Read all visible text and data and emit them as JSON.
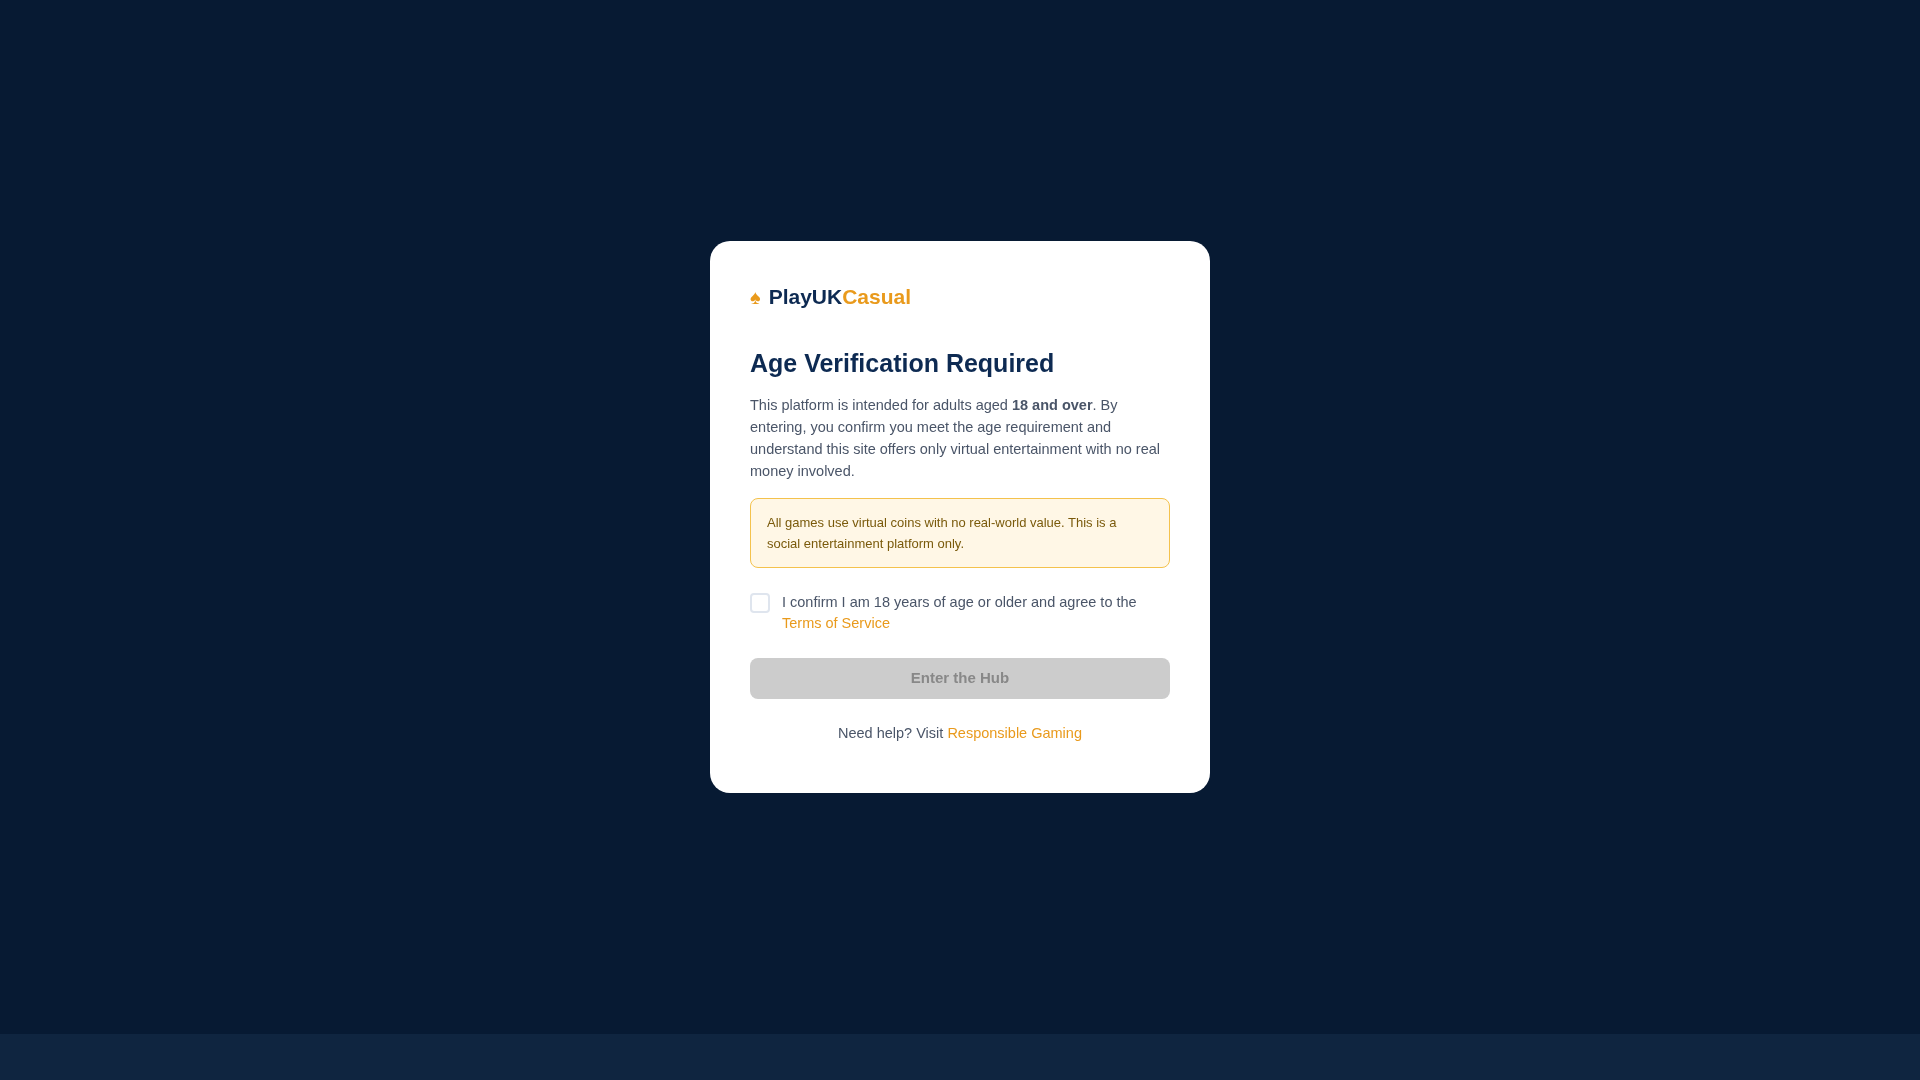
{
  "modal": {
    "logo": {
      "icon": "♠",
      "brand_main": "PlayUK",
      "brand_accent": "Casual"
    },
    "title": "Age Verification Required",
    "description": "This platform is intended for adults aged **18 and over**. By entering, you confirm you meet the age requirement and understand this site offers only virtual entertainment with no real money involved.",
    "notice": "All games use virtual coins with no real-world value. This is a social entertainment platform only.",
    "confirm": {
      "checked": false,
      "label": "I confirm I am 18 years of age or older and agree to the",
      "link": "Terms of Service"
    },
    "button": {
      "label": "Enter the Hub",
      "disabled": true
    },
    "help": {
      "text": "Need help? Visit",
      "link": "Responsible Gaming"
    }
  }
}
